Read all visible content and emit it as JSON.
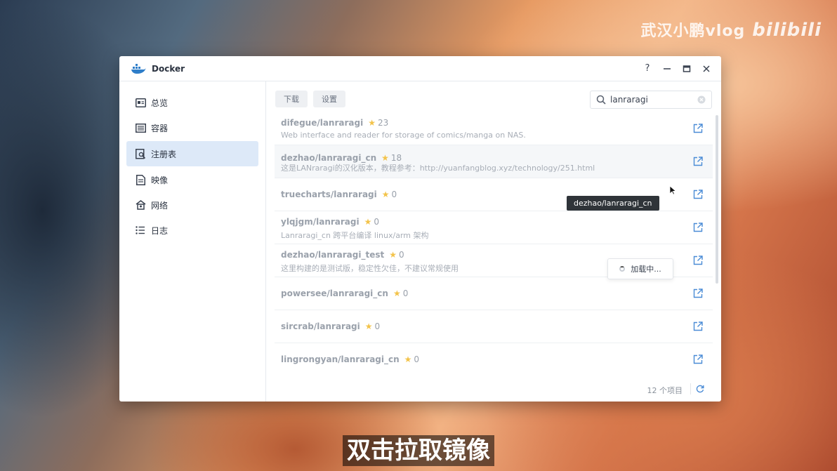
{
  "watermark": {
    "channel": "武汉小鹏vlog",
    "site": "bilibili"
  },
  "subtitle": "双击拉取镜像",
  "window": {
    "title": "Docker",
    "controls": {
      "help": "?",
      "minimize": "–",
      "maximize": "□",
      "close": "✕"
    }
  },
  "sidebar": {
    "items": [
      {
        "label": "总览",
        "icon": "overview-icon"
      },
      {
        "label": "容器",
        "icon": "container-icon"
      },
      {
        "label": "注册表",
        "icon": "registry-icon",
        "active": true
      },
      {
        "label": "映像",
        "icon": "image-icon"
      },
      {
        "label": "网络",
        "icon": "network-icon"
      },
      {
        "label": "日志",
        "icon": "log-icon"
      }
    ]
  },
  "toolbar": {
    "download_label": "下载",
    "settings_label": "设置"
  },
  "search": {
    "value": "lanraragi"
  },
  "results": [
    {
      "name": "difegue/lanraragi",
      "stars": "23",
      "description": "Web interface and reader for storage of comics/manga on NAS."
    },
    {
      "name": "dezhao/lanraragi_cn",
      "stars": "18",
      "description": "这是LANraragi的汉化版本，教程参考：http://yuanfangblog.xyz/technology/251.html"
    },
    {
      "name": "truecharts/lanraragi",
      "stars": "0",
      "description": ""
    },
    {
      "name": "ylqjgm/lanraragi",
      "stars": "0",
      "description": "Lanraragi_cn 跨平台编译 linux/arm 架构"
    },
    {
      "name": "dezhao/lanraragi_test",
      "stars": "0",
      "description": "这里构建的是测试版，稳定性欠佳，不建议常规使用"
    },
    {
      "name": "powersee/lanraragi_cn",
      "stars": "0",
      "description": ""
    },
    {
      "name": "sircrab/lanraragi",
      "stars": "0",
      "description": ""
    },
    {
      "name": "lingrongyan/lanraragi_cn",
      "stars": "0",
      "description": ""
    }
  ],
  "footer": {
    "count": "12 个项目"
  },
  "tooltip": "dezhao/lanraragi_cn",
  "loading": "加载中...",
  "colors": {
    "accent": "#dde9f8",
    "star": "#f3c34a",
    "docker_blue": "#2f7ec9"
  }
}
